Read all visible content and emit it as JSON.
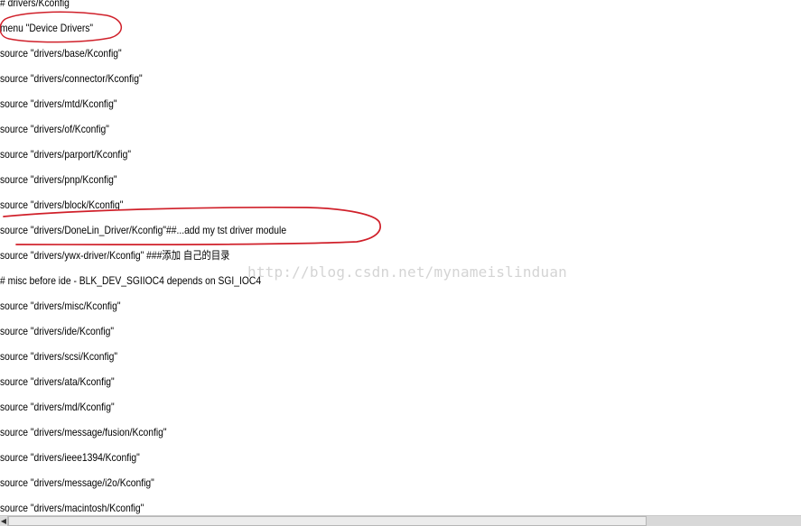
{
  "editor": {
    "lines": [
      "# drivers/Kconfig",
      "menu \"Device Drivers\"",
      "source \"drivers/base/Kconfig\"",
      "source \"drivers/connector/Kconfig\"",
      "source \"drivers/mtd/Kconfig\"",
      "source \"drivers/of/Kconfig\"",
      "source \"drivers/parport/Kconfig\"",
      "source \"drivers/pnp/Kconfig\"",
      "source \"drivers/block/Kconfig\"",
      "source \"drivers/DoneLin_Driver/Kconfig\"##...add my tst driver module",
      "source \"drivers/ywx-driver/Kconfig\" ###添加 自己的目录",
      "# misc before ide - BLK_DEV_SGIIOC4 depends on SGI_IOC4",
      "source \"drivers/misc/Kconfig\"",
      "source \"drivers/ide/Kconfig\"",
      "source \"drivers/scsi/Kconfig\"",
      "source \"drivers/ata/Kconfig\"",
      "source \"drivers/md/Kconfig\"",
      "source \"drivers/message/fusion/Kconfig\"",
      "source \"drivers/ieee1394/Kconfig\"",
      "source \"drivers/message/i2o/Kconfig\"",
      "source \"drivers/macintosh/Kconfig\""
    ]
  },
  "watermark": "http://blog.csdn.net/mynameislinduan",
  "annotation_color": "#d0202a",
  "scrollbar": {
    "left_arrow_icon": "arrow-left-icon",
    "left_arrow_glyph": "◀"
  }
}
